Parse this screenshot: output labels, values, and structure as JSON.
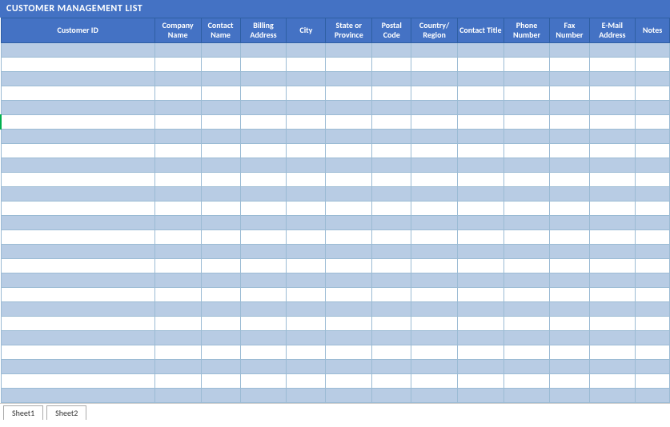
{
  "title": "CUSTOMER MANAGEMENT LIST",
  "columns": [
    {
      "key": "customer_id",
      "label": "Customer ID",
      "class": "col-customer-id"
    },
    {
      "key": "company_name",
      "label": "Company Name",
      "class": "col-company"
    },
    {
      "key": "contact_name",
      "label": "Contact Name",
      "class": "col-contact"
    },
    {
      "key": "billing_address",
      "label": "Billing Address",
      "class": "col-billing"
    },
    {
      "key": "city",
      "label": "City",
      "class": "col-city"
    },
    {
      "key": "state_province",
      "label": "State or Province",
      "class": "col-state"
    },
    {
      "key": "postal_code",
      "label": "Postal Code",
      "class": "col-postal"
    },
    {
      "key": "country_region",
      "label": "Country/ Region",
      "class": "col-country"
    },
    {
      "key": "contact_title",
      "label": "Contact Title",
      "class": "col-ctitle"
    },
    {
      "key": "phone_number",
      "label": "Phone Number",
      "class": "col-phone"
    },
    {
      "key": "fax_number",
      "label": "Fax Number",
      "class": "col-fax"
    },
    {
      "key": "email_address",
      "label": "E-Mail Address",
      "class": "col-email"
    },
    {
      "key": "notes",
      "label": "Notes",
      "class": "col-notes"
    }
  ],
  "row_count": 25,
  "bottom_tabs": [
    "Sheet1",
    "Sheet2"
  ]
}
